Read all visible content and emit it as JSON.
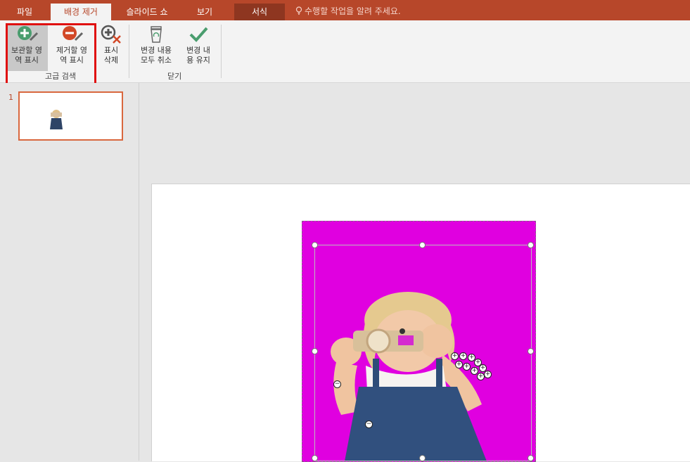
{
  "tabs": [
    {
      "label": "파일"
    },
    {
      "label": "배경 제거"
    },
    {
      "label": "슬라이드 쇼"
    },
    {
      "label": "보기"
    },
    {
      "label": "서식"
    }
  ],
  "tell_me": "수행할 작업을 알려 주세요.",
  "ribbon": {
    "keep_line1": "보관할 영",
    "keep_line2": "역 표시",
    "remove_line1": "제거할 영",
    "remove_line2": "역 표시",
    "delete_mark_line1": "표시",
    "delete_mark_line2": "삭제",
    "refine_group": "고급 검색",
    "discard_line1": "변경 내용",
    "discard_line2": "모두 취소",
    "keep_changes_line1": "변경 내",
    "keep_changes_line2": "용 유지",
    "close_group": "닫기"
  },
  "slides": {
    "number": "1"
  },
  "colors": {
    "accent": "#b7472a",
    "highlight_box": "#e01010",
    "removal_overlay": "#e000e0",
    "keep_icon": "#4a9d6e",
    "remove_icon": "#d24726"
  }
}
